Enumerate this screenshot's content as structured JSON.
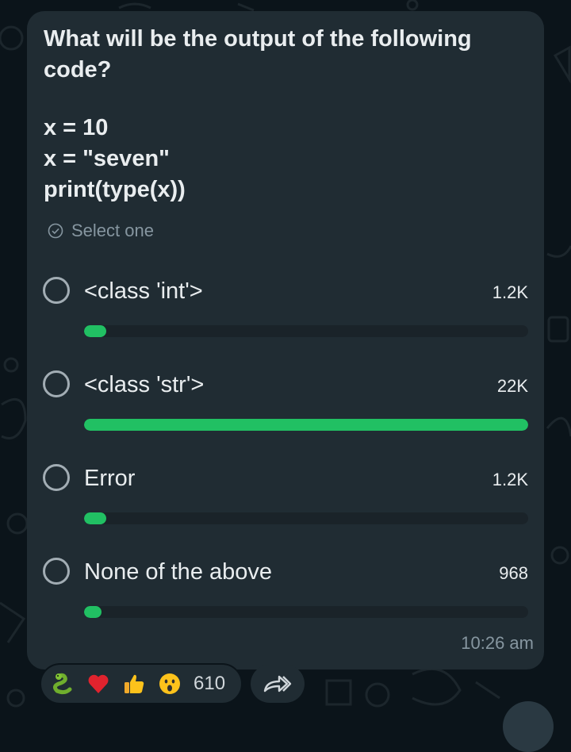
{
  "poll": {
    "question": "What will be the output of the following code?",
    "code_lines": [
      "x = 10",
      "x = \"seven\"",
      "print(type(x))"
    ],
    "select_hint": "Select one",
    "options": [
      {
        "label": "<class 'int'>",
        "count": "1.2K",
        "fraction": 0.05
      },
      {
        "label": "<class 'str'>",
        "count": "22K",
        "fraction": 1.0
      },
      {
        "label": "Error",
        "count": "1.2K",
        "fraction": 0.05
      },
      {
        "label": "None of the above",
        "count": "968",
        "fraction": 0.04
      }
    ],
    "time": "10:26 am"
  },
  "reactions": {
    "emojis": [
      "snake-emoji",
      "heart-emoji",
      "thumbs-up-emoji",
      "surprised-face-emoji"
    ],
    "count": "610"
  },
  "colors": {
    "bubble": "#202c33",
    "background": "#0b141a",
    "progress_fill": "#21c063",
    "progress_track": "#1a2329",
    "muted_text": "#8696a0"
  }
}
